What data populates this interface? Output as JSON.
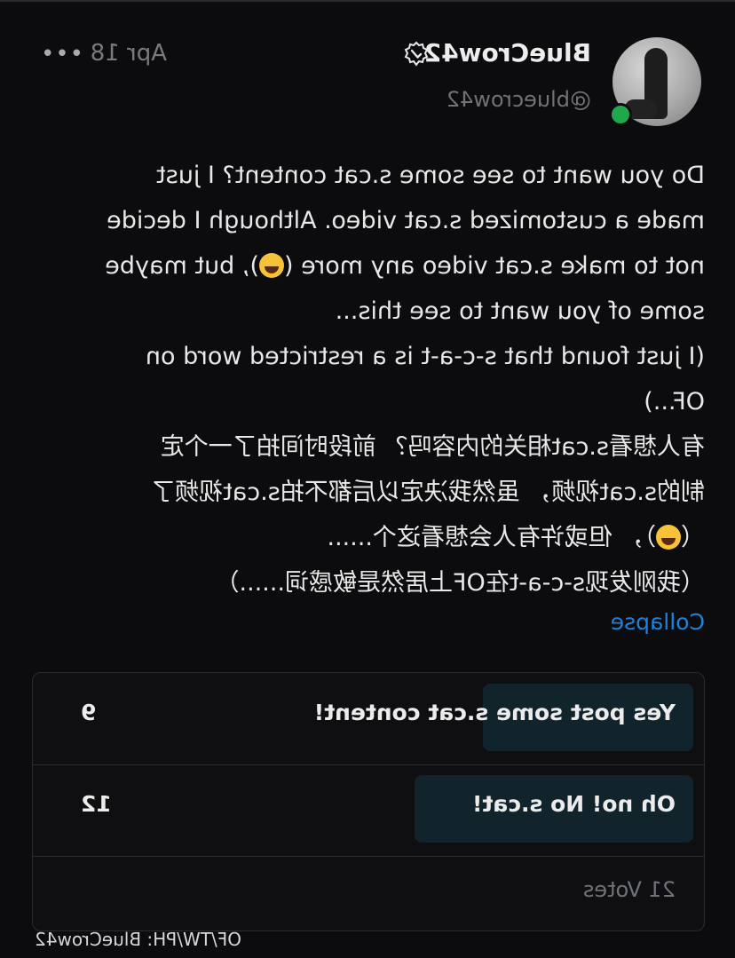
{
  "post": {
    "username": "BlueCrow42",
    "handle": "@bluecrow42",
    "date": "Apr 18",
    "more_label": "•••",
    "online_color": "#1fa84c",
    "verified_icon": "verified-badge-icon",
    "body_lines": [
      "Do you want to see some s.cat content? I just",
      "made a customized s.cat video. Although I decide",
      "not to make s.cat video any more (😂), but maybe",
      "some of you want to see this...",
      "(I just found that s-c-a-t is a restricted word on",
      "OF...)",
      "有人想看s.cat相关的内容吗？ 前段时间拍了一个定",
      "制的s.cat视频， 虽然我决定以后都不拍s.cat视频了",
      "（😂）， 但或许有人会想看这个......",
      "（我刚发现s-c-a-t在OF上居然是敏感词......）"
    ],
    "collapse_label": "Collapse"
  },
  "poll": {
    "options": [
      {
        "label": "Yes post some s.cat content!",
        "votes": "9",
        "share": 0.43
      },
      {
        "label": "Oh no! No s.cat!",
        "votes": "12",
        "share": 0.57
      }
    ],
    "total_label": "21 Votes",
    "fill_color": "#11232b"
  },
  "watermark": "OF/TW/PH: BlueCrow42",
  "accent_link_color": "#1d82d9"
}
